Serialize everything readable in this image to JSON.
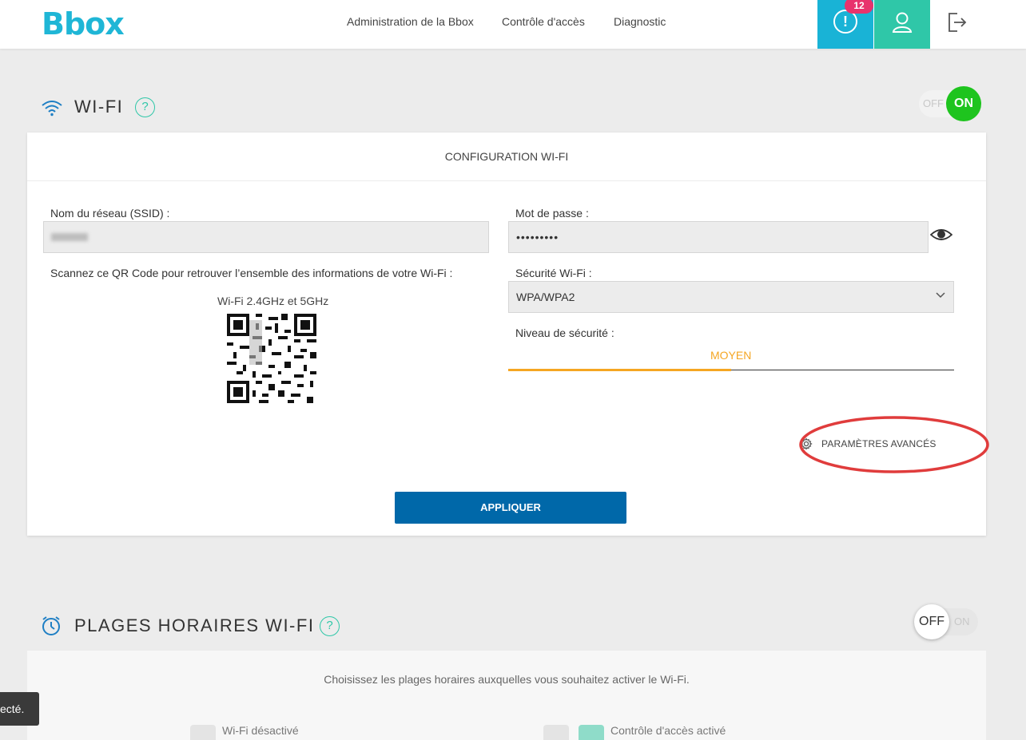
{
  "header": {
    "logo": "Bbox",
    "nav": [
      "Administration de la Bbox",
      "Contrôle d'accès",
      "Diagnostic"
    ],
    "alert_symbol": "!",
    "alert_count": "12",
    "icons": {
      "alert": "alert-circle-icon",
      "user": "user-icon",
      "logout": "logout-icon"
    },
    "colors": {
      "alert_bg": "#19b3d6",
      "user_bg": "#2fc7a8",
      "badge": "#e8336d",
      "logo": "#1fb6d6"
    }
  },
  "wifi_section": {
    "title": "WI-FI",
    "help": "?",
    "toggle": {
      "off_label": "OFF",
      "on_label": "ON",
      "state": "ON"
    }
  },
  "config_card": {
    "heading": "CONFIGURATION WI-FI",
    "ssid_label": "Nom du réseau (SSID) :",
    "password_label": "Mot de passe :",
    "password_value": "•••••••••",
    "qr_instruction": "Scannez ce QR Code pour retrouver l’ensemble des informations de votre Wi-Fi :",
    "qr_caption": "Wi-Fi 2.4GHz et 5GHz",
    "security_label": "Sécurité Wi-Fi :",
    "security_value": "WPA/WPA2",
    "level_label": "Niveau de sécurité :",
    "level_value": "MOYEN",
    "level_fraction": 0.5,
    "advanced_label": "PARAMÈTRES AVANCÉS",
    "apply_label": "APPLIQUER",
    "colors": {
      "apply": "#0068a9",
      "level": "#f5a623",
      "annotation": "#e03c3c"
    }
  },
  "plages_section": {
    "title": "PLAGES HORAIRES WI-FI",
    "help": "?",
    "toggle": {
      "off_label": "OFF",
      "on_label": "ON",
      "state": "OFF"
    },
    "description": "Choisissez les plages horaires auxquelles vous souhaitez activer le Wi-Fi.",
    "legend": [
      "Wi-Fi désactivé",
      "Contrôle d'accès activé"
    ]
  },
  "toast": {
    "text": "ecté."
  }
}
